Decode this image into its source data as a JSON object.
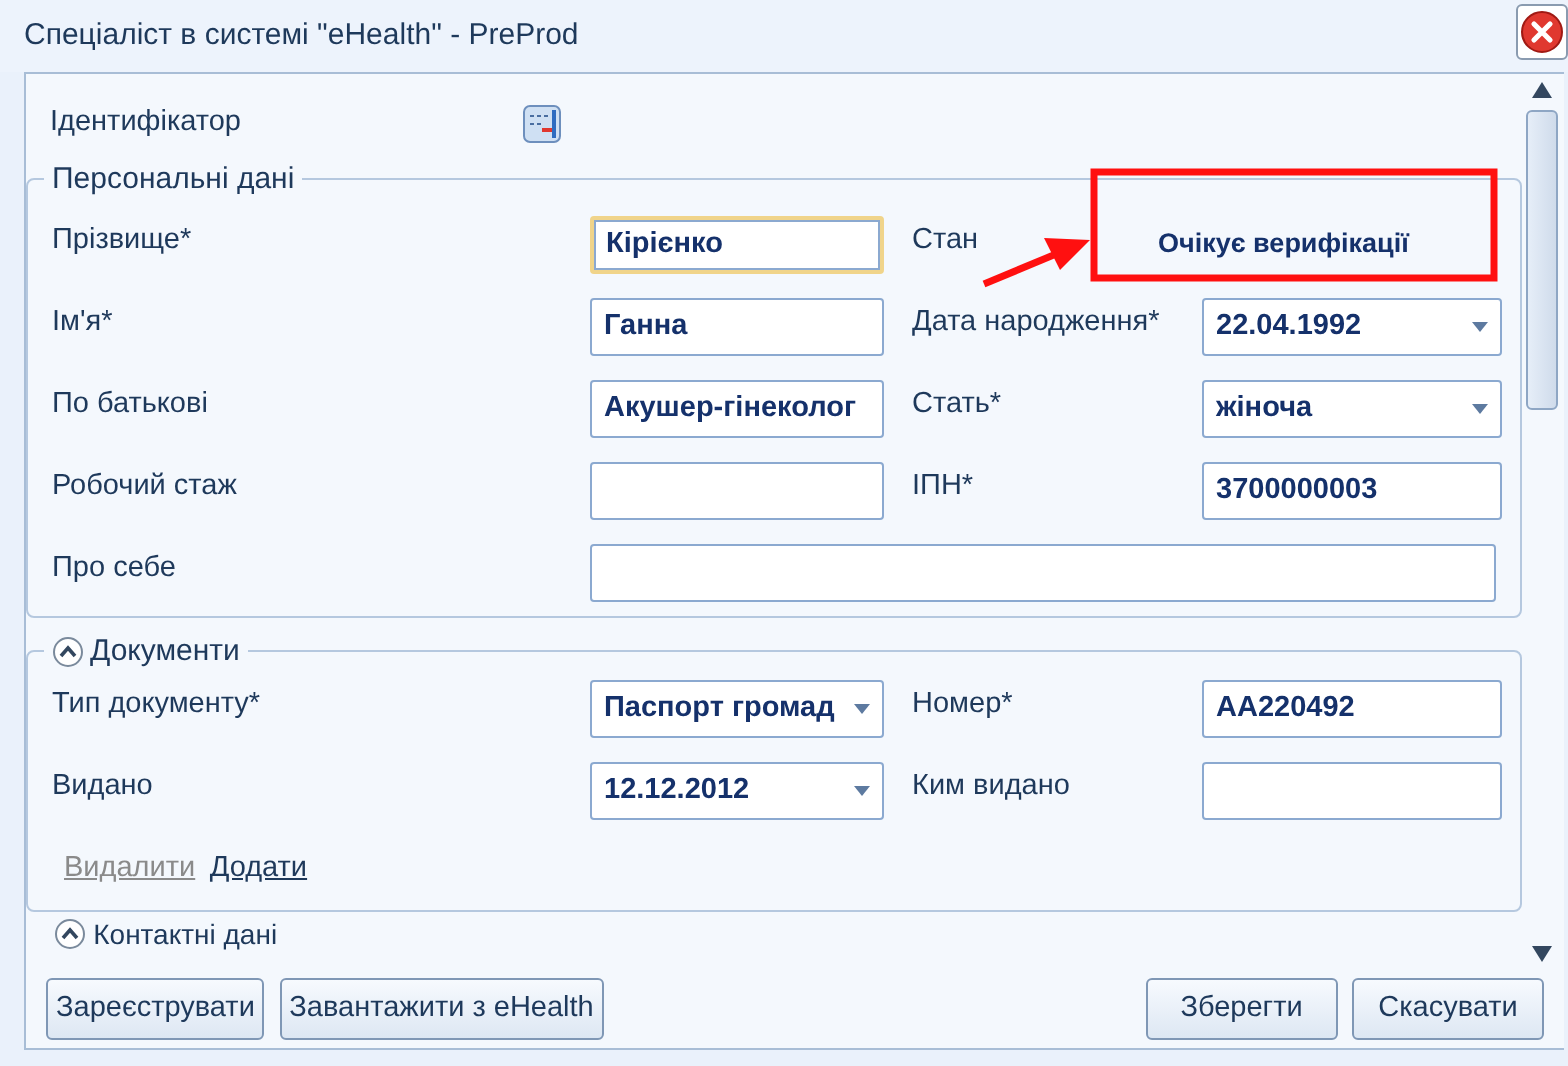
{
  "window": {
    "title": "Спеціаліст в системі \"eHealth\" - PreProd"
  },
  "identifier": {
    "label": "Ідентифікатор"
  },
  "personal": {
    "title": "Персональні дані",
    "rows": [
      {
        "left": {
          "label": "Прізвище*",
          "kind": "text",
          "value": "Кірієнко",
          "focused": true
        },
        "right": {
          "label": "Стан",
          "kind": "status",
          "value": "Очікує верифікації"
        }
      },
      {
        "left": {
          "label": "Ім'я*",
          "kind": "text",
          "value": "Ганна"
        },
        "right": {
          "label": "Дата народження*",
          "kind": "select",
          "value": "22.04.1992"
        }
      },
      {
        "left": {
          "label": "По батькові",
          "kind": "text",
          "value": "Акушер-гінеколог"
        },
        "right": {
          "label": "Стать*",
          "kind": "select",
          "value": "жіноча"
        }
      },
      {
        "left": {
          "label": "Робочий стаж",
          "kind": "text"
        },
        "right": {
          "label": "ІПН*",
          "kind": "text",
          "value": "3700000003"
        }
      },
      {
        "left": {
          "label": "Про себе",
          "kind": "wide"
        }
      }
    ]
  },
  "documents": {
    "title": "Документи",
    "rows": [
      {
        "left": {
          "label": "Тип документу*",
          "kind": "select",
          "value": "Паспорт громад"
        },
        "right": {
          "label": "Номер*",
          "kind": "text",
          "value": "АА220492"
        }
      },
      {
        "left": {
          "label": "Видано",
          "kind": "select",
          "value": "12.12.2012"
        },
        "right": {
          "label": "Ким видано",
          "kind": "text"
        }
      }
    ],
    "links": [
      {
        "label": "Видалити",
        "disabled": true
      },
      {
        "label": "Додати",
        "disabled": false
      }
    ]
  },
  "contacts": {
    "title": "Контактні дані"
  },
  "buttons_left": [
    "Зареєструвати",
    "Завантажити з eHealth"
  ],
  "buttons_right": [
    "Зберегти",
    "Скасувати"
  ]
}
